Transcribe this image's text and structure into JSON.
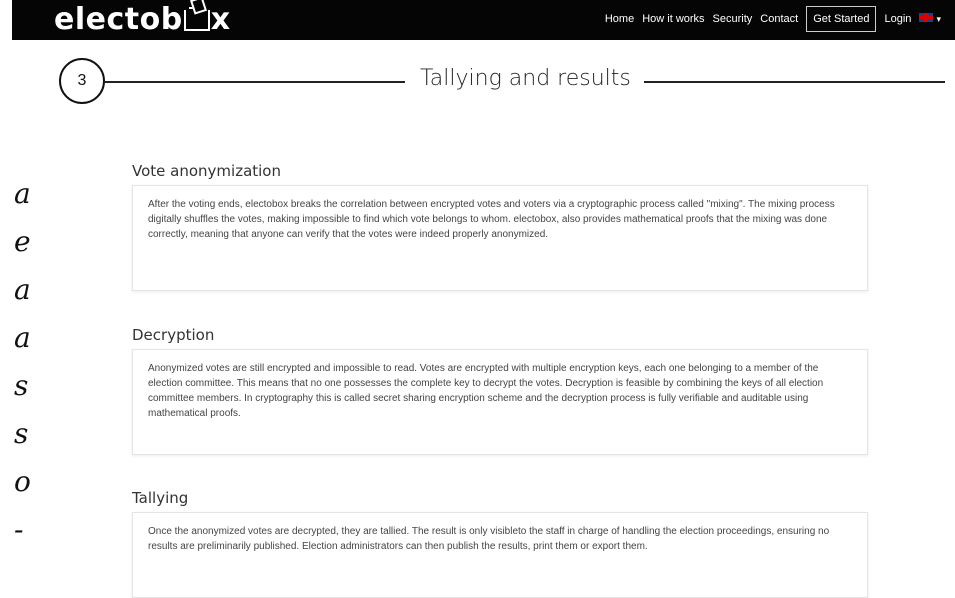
{
  "brand": {
    "name_prefix": "electob",
    "name_suffix": "x"
  },
  "nav": {
    "home": "Home",
    "how": "How it works",
    "security": "Security",
    "contact": "Contact",
    "cta": "Get Started",
    "login": "Login"
  },
  "step": {
    "number": "3",
    "title": "Tallying and results"
  },
  "left_edge_chars": [
    "a",
    "e",
    "a",
    "a",
    "s",
    "s",
    "o",
    "-"
  ],
  "sections": [
    {
      "heading": "Vote anonymization",
      "body": "After the voting ends, electobox breaks the correlation between encrypted votes and voters via a cryptographic process called \"mixing\". The mixing process digitally shuffles the votes, making impossible to find which vote belongs to whom. electobox, also provides mathematical proofs that the mixing was done correctly, meaning that anyone can verify that the votes were indeed properly anonymized."
    },
    {
      "heading": "Decryption",
      "body": "Anonymized votes are still encrypted and impossible to read. Votes are encrypted with multiple encryption keys, each one belonging to a member of the election committee. This means that no one possesses the complete key to decrypt the votes. Decryption is feasible by combining the keys of all election committee members. In cryptography this is called secret sharing encryption scheme and the decryption process is fully verifiable and auditable using mathematical proofs."
    },
    {
      "heading": "Tallying",
      "body": "Once the anonymized votes are decrypted, they are tallied. The result is only visibleto the staff in charge of handling the election proceedings, ensuring no results are preliminarily published. Election administrators can then publish the results, print them or export them."
    }
  ]
}
